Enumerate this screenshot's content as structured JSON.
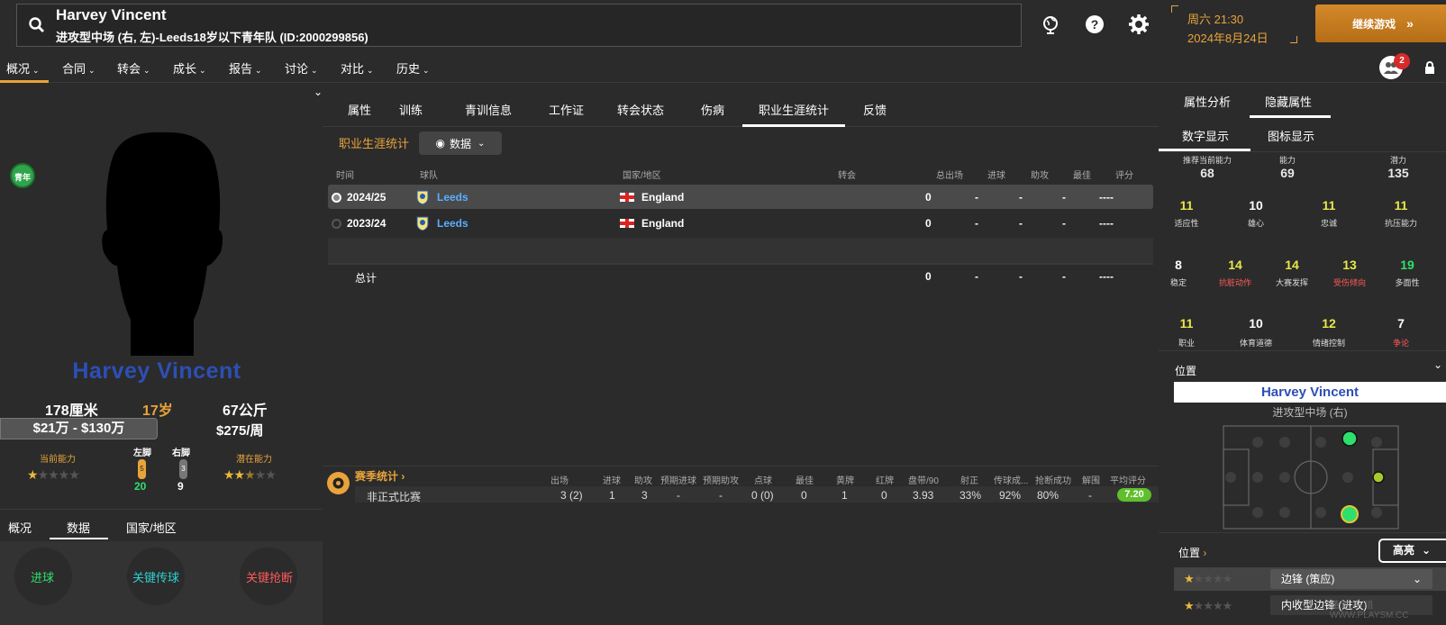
{
  "header": {
    "name": "Harvey Vincent",
    "subtitle": "进攻型中场 (右, 左)-Leeds18岁以下青年队 (ID:2000299856)",
    "day_time": "周六 21:30",
    "date": "2024年8月24日",
    "continue_label": "继续游戏",
    "continue_icon": "double-chevron-right"
  },
  "nav": {
    "items": [
      "概况",
      "合同",
      "转会",
      "成长",
      "报告",
      "讨论",
      "对比",
      "历史"
    ],
    "badge": "2"
  },
  "profile": {
    "badge": "青年",
    "name": "Harvey Vincent",
    "height": "178厘米",
    "age": "17岁",
    "weight": "67公斤",
    "value": "$21万 - $130万",
    "wage": "$275/周",
    "current_ability_label": "当前能力",
    "potential_label": "潜在能力",
    "left_foot_label": "左脚",
    "right_foot_label": "右脚",
    "left_foot_value": "5",
    "right_foot_value": "3",
    "left_foot_num": "20",
    "right_foot_num": "9",
    "current_stars": 1,
    "potential_stars": 2.5
  },
  "left_tabs": [
    "概况",
    "数据",
    "国家/地区"
  ],
  "left_metrics": [
    "进球",
    "关键传球",
    "关键抢断"
  ],
  "mid_tabs": [
    "属性",
    "训练",
    "青训信息",
    "工作证",
    "转会状态",
    "伤病",
    "职业生涯统计",
    "反馈"
  ],
  "career": {
    "title": "职业生涯统计",
    "view_label": "数据",
    "columns": [
      "时间",
      "球队",
      "国家/地区",
      "转会",
      "总出场",
      "进球",
      "助攻",
      "最佳",
      "评分"
    ],
    "rows": [
      {
        "season": "2024/25",
        "team": "Leeds",
        "country": "England",
        "apps": "0",
        "goals": "-",
        "assists": "-",
        "best": "-",
        "rating": "----"
      },
      {
        "season": "2023/24",
        "team": "Leeds",
        "country": "England",
        "apps": "0",
        "goals": "-",
        "assists": "-",
        "best": "-",
        "rating": "----"
      }
    ],
    "total_label": "总计",
    "total": {
      "apps": "0",
      "goals": "-",
      "assists": "-",
      "best": "-",
      "rating": "----"
    }
  },
  "season": {
    "title": "赛季统计",
    "columns": [
      "出场",
      "进球",
      "助攻",
      "预期进球",
      "预期助攻",
      "点球",
      "最佳",
      "黄牌",
      "红牌",
      "盘带/90",
      "射正",
      "传球成...",
      "抢断成功",
      "解围",
      "平均评分"
    ],
    "row_label": "非正式比赛",
    "values": [
      "3 (2)",
      "1",
      "3",
      "-",
      "-",
      "0 (0)",
      "0",
      "1",
      "0",
      "3.93",
      "33%",
      "92%",
      "80%",
      "-",
      "7.20"
    ]
  },
  "right": {
    "tabs": [
      "属性分析",
      "隐藏属性"
    ],
    "subtabs": [
      "数字显示",
      "图标显示"
    ],
    "top": [
      {
        "label": "推荐当前能力",
        "value": "68"
      },
      {
        "label": "能力",
        "value": "69"
      },
      {
        "label": "潜力",
        "value": "135"
      }
    ],
    "attrs": [
      {
        "v": "11",
        "l": "适应性"
      },
      {
        "v": "10",
        "l": "雄心"
      },
      {
        "v": "11",
        "l": "忠诚"
      },
      {
        "v": "11",
        "l": "抗压能力"
      },
      {
        "v": "8",
        "l": "稳定"
      },
      {
        "v": "14",
        "l": "抗脏动作"
      },
      {
        "v": "14",
        "l": "大赛发挥"
      },
      {
        "v": "13",
        "l": "受伤倾向"
      },
      {
        "v": "19",
        "l": "多面性"
      },
      {
        "v": "11",
        "l": "职业"
      },
      {
        "v": "10",
        "l": "体育道德"
      },
      {
        "v": "12",
        "l": "情绪控制"
      },
      {
        "v": "7",
        "l": "争论"
      }
    ],
    "position_label": "位置",
    "pos_name": "Harvey Vincent",
    "pos_role": "进攻型中场 (右)",
    "pos_label2": "位置",
    "highlight": "高亮",
    "roles": [
      "边锋 (策应)",
      "内收型边锋 (进攻)"
    ],
    "watermark": "懂 球 小 组 WWW.PLAYSM.CC"
  },
  "colors": {
    "accent": "#e9a33b",
    "green": "#2ee06b",
    "yellow": "#e8e84a",
    "red": "#ff5a5a",
    "blue_name": "#2d4fb5"
  }
}
